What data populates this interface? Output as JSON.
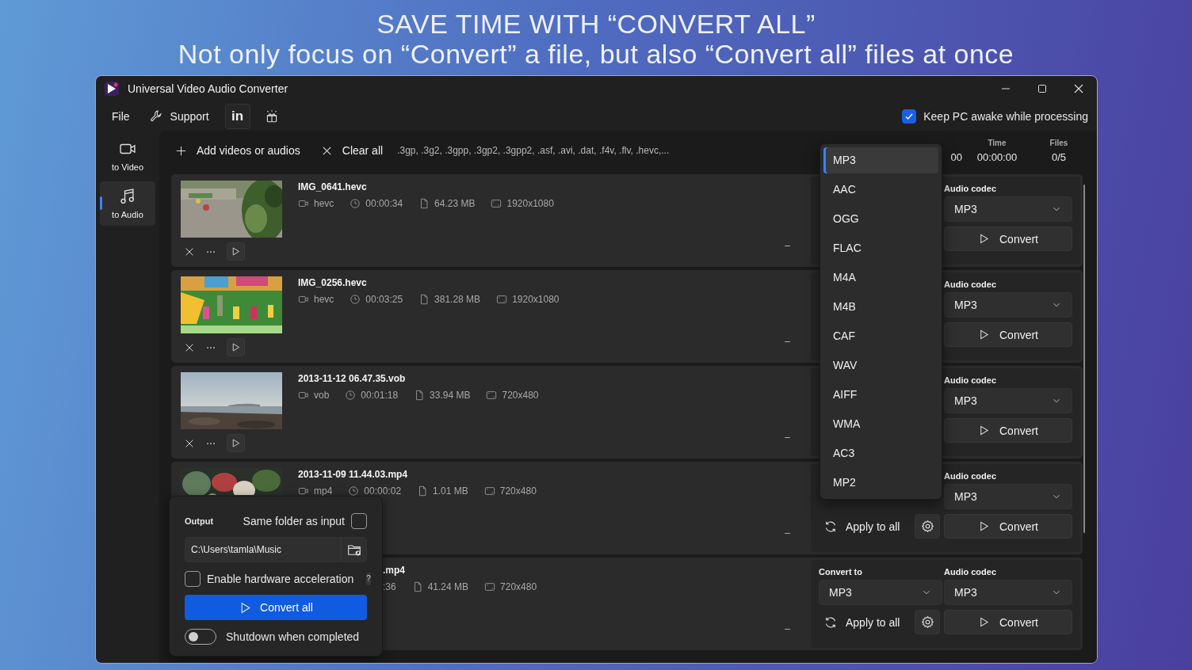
{
  "headline": [
    "SAVE TIME WITH “CONVERT ALL”",
    "Not only focus on “Convert” a file, but also “Convert all” files at once"
  ],
  "window": {
    "title": "Universal Video Audio Converter"
  },
  "menu": [
    {
      "kind": "text",
      "label": "File"
    },
    {
      "kind": "wrench",
      "label": "Support"
    },
    {
      "kind": "boxed",
      "label": "in"
    },
    {
      "kind": "gift"
    }
  ],
  "keep_awake": {
    "label": "Keep PC awake while processing",
    "checked": true
  },
  "nav": [
    {
      "kind": "video",
      "label": "to Video",
      "selected": false
    },
    {
      "kind": "audio",
      "label": "to Audio",
      "selected": true
    }
  ],
  "toolbar": {
    "add": "Add videos or audios",
    "clear": "Clear all",
    "formats": ".3gp, .3g2, .3gpp, .3gp2, .3gpp2, .asf, .avi, .dat, .f4v, .flv, .hevc,..."
  },
  "stats": [
    {
      "value": "00"
    },
    {
      "label": "Time",
      "value": "00:00:00"
    },
    {
      "label": "Files",
      "value": "0/5"
    }
  ],
  "files": [
    {
      "thumbnail": true,
      "cropped": false,
      "actions": true,
      "covered": false,
      "name": "IMG_0641.hevc",
      "meta": [
        {
          "kind": "codec",
          "text": "hevc"
        },
        {
          "kind": "duration",
          "text": "00:00:34"
        },
        {
          "kind": "size",
          "text": "64.23 MB"
        },
        {
          "kind": "resolution",
          "text": "1920x1080"
        }
      ],
      "status": "–",
      "codec": {
        "label": "Audio codec",
        "value": "MP3"
      },
      "convert": "Convert"
    },
    {
      "thumbnail": true,
      "cropped": false,
      "actions": true,
      "covered": false,
      "name": "IMG_0256.hevc",
      "meta": [
        {
          "kind": "codec",
          "text": "hevc"
        },
        {
          "kind": "duration",
          "text": "00:03:25"
        },
        {
          "kind": "size",
          "text": "381.28 MB"
        },
        {
          "kind": "resolution",
          "text": "1920x1080"
        }
      ],
      "status": "–",
      "codec": {
        "label": "Audio codec",
        "value": "MP3"
      },
      "convert": "Convert"
    },
    {
      "thumbnail": true,
      "cropped": false,
      "actions": true,
      "covered": false,
      "name": "2013-11-12 06.47.35.vob",
      "meta": [
        {
          "kind": "codec",
          "text": "vob"
        },
        {
          "kind": "duration",
          "text": "00:01:18"
        },
        {
          "kind": "size",
          "text": "33.94 MB"
        },
        {
          "kind": "resolution",
          "text": "720x480"
        }
      ],
      "status": "–",
      "codec": {
        "label": "Audio codec",
        "value": "MP3"
      },
      "convert": "Convert"
    },
    {
      "thumbnail": true,
      "cropped": true,
      "actions": false,
      "covered": false,
      "name": "2013-11-09 11.44.03.mp4",
      "meta": [
        {
          "kind": "codec",
          "text": "mp4"
        },
        {
          "kind": "duration",
          "text": "00:00:02"
        },
        {
          "kind": "size",
          "text": "1.01 MB"
        },
        {
          "kind": "resolution",
          "text": "720x480"
        }
      ],
      "status": "–",
      "apply_all": "Apply to all",
      "settings": true,
      "codec": {
        "label": "Audio codec",
        "value": "MP3"
      },
      "convert": "Convert"
    },
    {
      "thumbnail": false,
      "actions": false,
      "covered": true,
      "name": ".mp4",
      "meta": [
        {
          "kind": "plain",
          "text": ":36"
        },
        {
          "kind": "size",
          "text": "41.24 MB"
        },
        {
          "kind": "resolution",
          "text": "720x480"
        }
      ],
      "status": "–",
      "convert_to": {
        "label": "Convert to",
        "value": "MP3"
      },
      "apply_all": "Apply to all",
      "settings": true,
      "codec": {
        "label": "Audio codec",
        "value": "MP3"
      },
      "convert": "Convert"
    }
  ],
  "format_menu": [
    {
      "label": "MP3",
      "selected": true
    },
    {
      "label": "AAC",
      "selected": false
    },
    {
      "label": "OGG",
      "selected": false
    },
    {
      "label": "FLAC",
      "selected": false
    },
    {
      "label": "M4A",
      "selected": false
    },
    {
      "label": "M4B",
      "selected": false
    },
    {
      "label": "CAF",
      "selected": false
    },
    {
      "label": "WAV",
      "selected": false
    },
    {
      "label": "AIFF",
      "selected": false
    },
    {
      "label": "WMA",
      "selected": false
    },
    {
      "label": "AC3",
      "selected": false
    },
    {
      "label": "MP2",
      "selected": false
    }
  ],
  "output_panel": {
    "title": "Output",
    "same_folder": {
      "label": "Same folder as input",
      "checked": false
    },
    "path": "C:\\Users\\tamla\\Music",
    "hw_accel": {
      "label": "Enable hardware acceleration",
      "checked": false,
      "help": "?"
    },
    "convert_all": "Convert all",
    "shutdown": {
      "label": "Shutdown when completed",
      "on": false
    }
  }
}
